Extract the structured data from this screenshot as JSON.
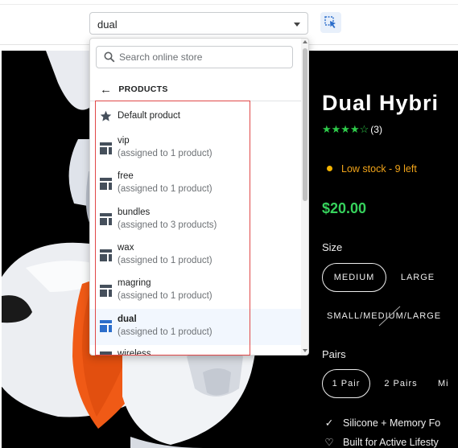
{
  "toolbar": {
    "template_select_value": "dual",
    "inspect_icon": "inspect-cursor-icon"
  },
  "dropdown": {
    "search_placeholder": "Search online store",
    "back_label": "PRODUCTS",
    "items": [
      {
        "icon": "star-icon",
        "label": "Default product",
        "sub": ""
      },
      {
        "icon": "template-icon",
        "label": "vip",
        "sub": "(assigned to 1 product)"
      },
      {
        "icon": "template-icon",
        "label": "free",
        "sub": "(assigned to 1 product)"
      },
      {
        "icon": "template-icon",
        "label": "bundles",
        "sub": "(assigned to 3 products)"
      },
      {
        "icon": "template-icon",
        "label": "wax",
        "sub": "(assigned to 1 product)"
      },
      {
        "icon": "template-icon",
        "label": "magring",
        "sub": "(assigned to 1 product)"
      },
      {
        "icon": "template-icon",
        "label": "dual",
        "sub": "(assigned to 1 product)",
        "active": true
      },
      {
        "icon": "template-icon",
        "label": "wireless",
        "sub": ""
      }
    ]
  },
  "product": {
    "title": "Dual Hybri",
    "rating_count": "(3)",
    "rating": 4,
    "rating_max": 5,
    "stock": "Low stock - 9 left",
    "price": "$20.00",
    "size_label": "Size",
    "sizes": [
      "MEDIUM",
      "LARGE",
      "SMALL/MEDIUM/LARGE"
    ],
    "selected_size": "MEDIUM",
    "pairs_label": "Pairs",
    "pairs": [
      "1 Pair",
      "2 Pairs",
      "Mi"
    ],
    "selected_pairs": "1 Pair",
    "features": [
      "Silicone + Memory Fo",
      "Built for Active Lifesty"
    ]
  },
  "colors": {
    "accent": "#2c6ecb",
    "stock": "#f0a319",
    "price": "#36d25c",
    "stars": "#2ecc4a",
    "highlight": "#e04848"
  }
}
